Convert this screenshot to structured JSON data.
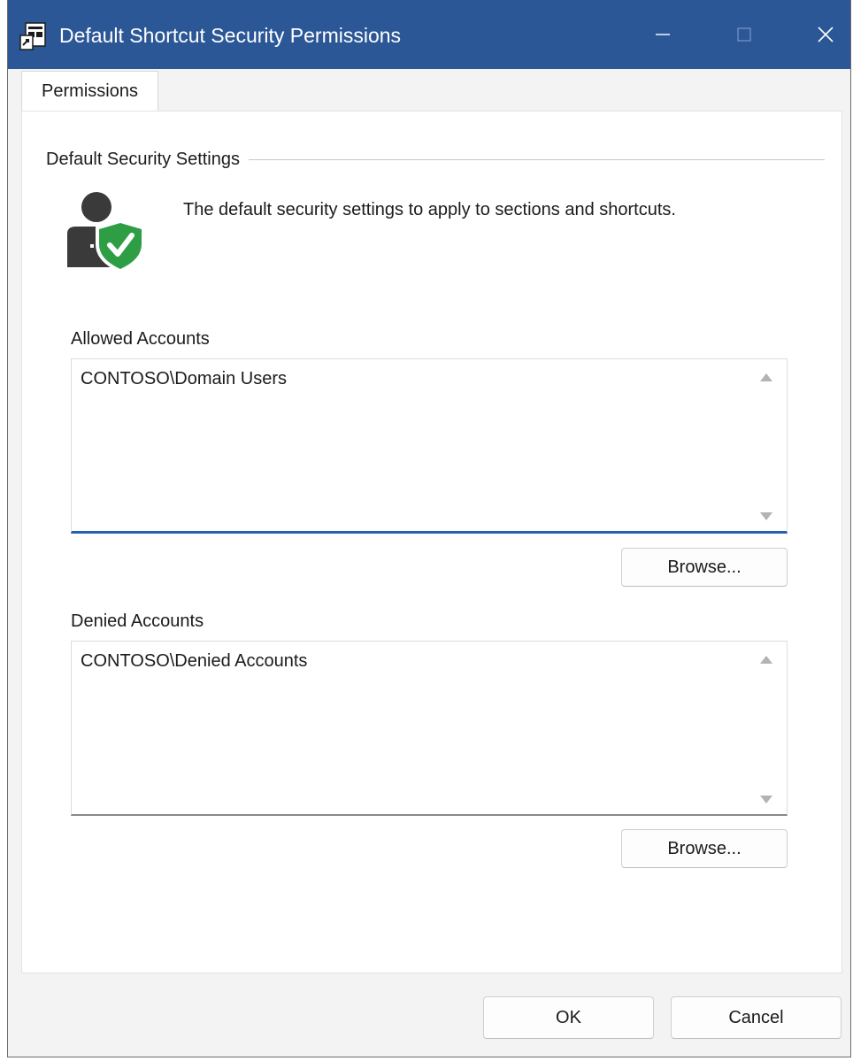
{
  "window": {
    "title": "Default Shortcut Security Permissions",
    "icon": "shortcut-permissions-icon",
    "controls": {
      "minimize": "minimize-icon",
      "maximize": "maximize-icon",
      "close": "close-icon"
    }
  },
  "tabs": [
    {
      "label": "Permissions",
      "active": true
    }
  ],
  "group": {
    "title": "Default Security Settings",
    "icon": "user-shield-icon",
    "description": "The default security settings to apply to sections and shortcuts."
  },
  "allowed": {
    "label": "Allowed Accounts",
    "items": [
      "CONTOSO\\Domain Users"
    ],
    "browse_label": "Browse..."
  },
  "denied": {
    "label": "Denied Accounts",
    "items": [
      "CONTOSO\\Denied Accounts"
    ],
    "browse_label": "Browse..."
  },
  "footer": {
    "ok_label": "OK",
    "cancel_label": "Cancel"
  },
  "colors": {
    "titlebar": "#2b5797",
    "focus_accent": "#1f62b0",
    "shield_green": "#2e9e45",
    "user_dark": "#3a3a3a"
  }
}
